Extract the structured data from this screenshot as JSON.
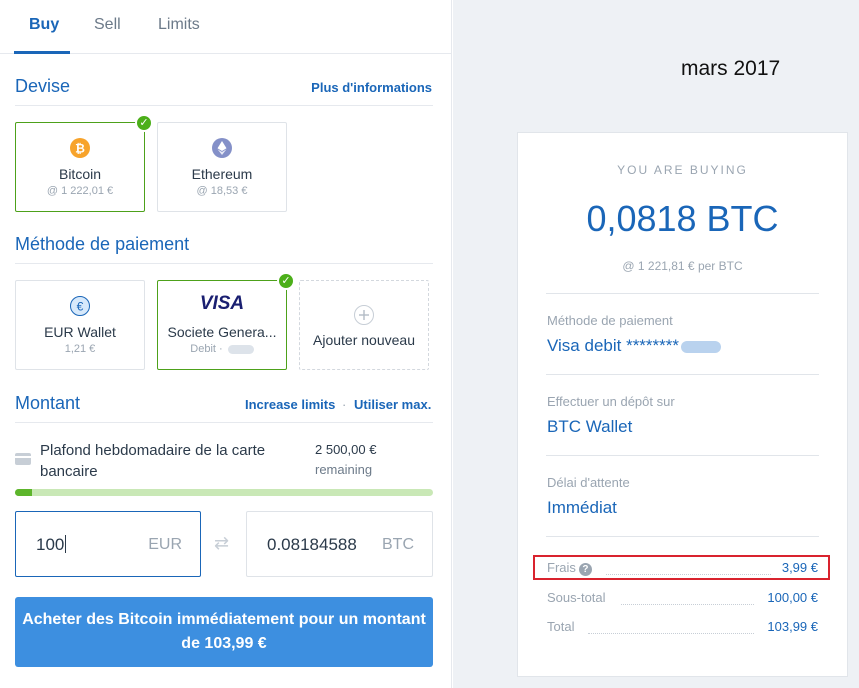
{
  "tabs": [
    {
      "label": "Buy"
    },
    {
      "label": "Sell"
    },
    {
      "label": "Limits"
    }
  ],
  "currency": {
    "title": "Devise",
    "more_info": "Plus d'informations",
    "options": [
      {
        "name": "Bitcoin",
        "price": "@ 1 222,01 €",
        "icon": "bitcoin-icon",
        "selected": true
      },
      {
        "name": "Ethereum",
        "price": "@ 18,53 €",
        "icon": "ethereum-icon",
        "selected": false
      }
    ]
  },
  "payment": {
    "title": "Méthode de paiement",
    "options": [
      {
        "name": "EUR Wallet",
        "sub": "1,21 €",
        "icon": "euro-icon"
      },
      {
        "logo": "VISA",
        "name": "Societe Genera...",
        "sub": "Debit · ",
        "icon": "visa-logo",
        "selected": true
      },
      {
        "name": "Ajouter nouveau",
        "icon": "plus-icon"
      }
    ]
  },
  "amount": {
    "title": "Montant",
    "increase_limits": "Increase limits",
    "separator": "·",
    "use_max": "Utiliser max.",
    "limit_label": "Plafond hebdomadaire de la carte bancaire",
    "limit_amount": "2 500,00 €",
    "limit_remaining": "remaining",
    "limit_used_fraction": 0.04,
    "fiat_value": "100",
    "fiat_currency": "EUR",
    "crypto_value": "0.08184588",
    "crypto_currency": "BTC"
  },
  "buy_button": "Acheter des Bitcoin immédiatement pour un montant de 103,99 €",
  "annotation": "mars 2017",
  "summary": {
    "heading": "YOU ARE BUYING",
    "amount": "0,0818 BTC",
    "rate": "@ 1 221,81 € per BTC",
    "payment_label": "Méthode de paiement",
    "payment_value": "Visa debit ********",
    "deposit_label": "Effectuer un dépôt sur",
    "deposit_value": "BTC Wallet",
    "delay_label": "Délai d'attente",
    "delay_value": "Immédiat",
    "fees_label": "Frais",
    "fees_value": "3,99 €",
    "subtotal_label": "Sous-total",
    "subtotal_value": "100,00 €",
    "total_label": "Total",
    "total_value": "103,99 €"
  },
  "colors": {
    "accent": "#1a66b8",
    "button": "#3d8fe0",
    "success": "#4caf1a",
    "highlight": "#d9232e"
  }
}
